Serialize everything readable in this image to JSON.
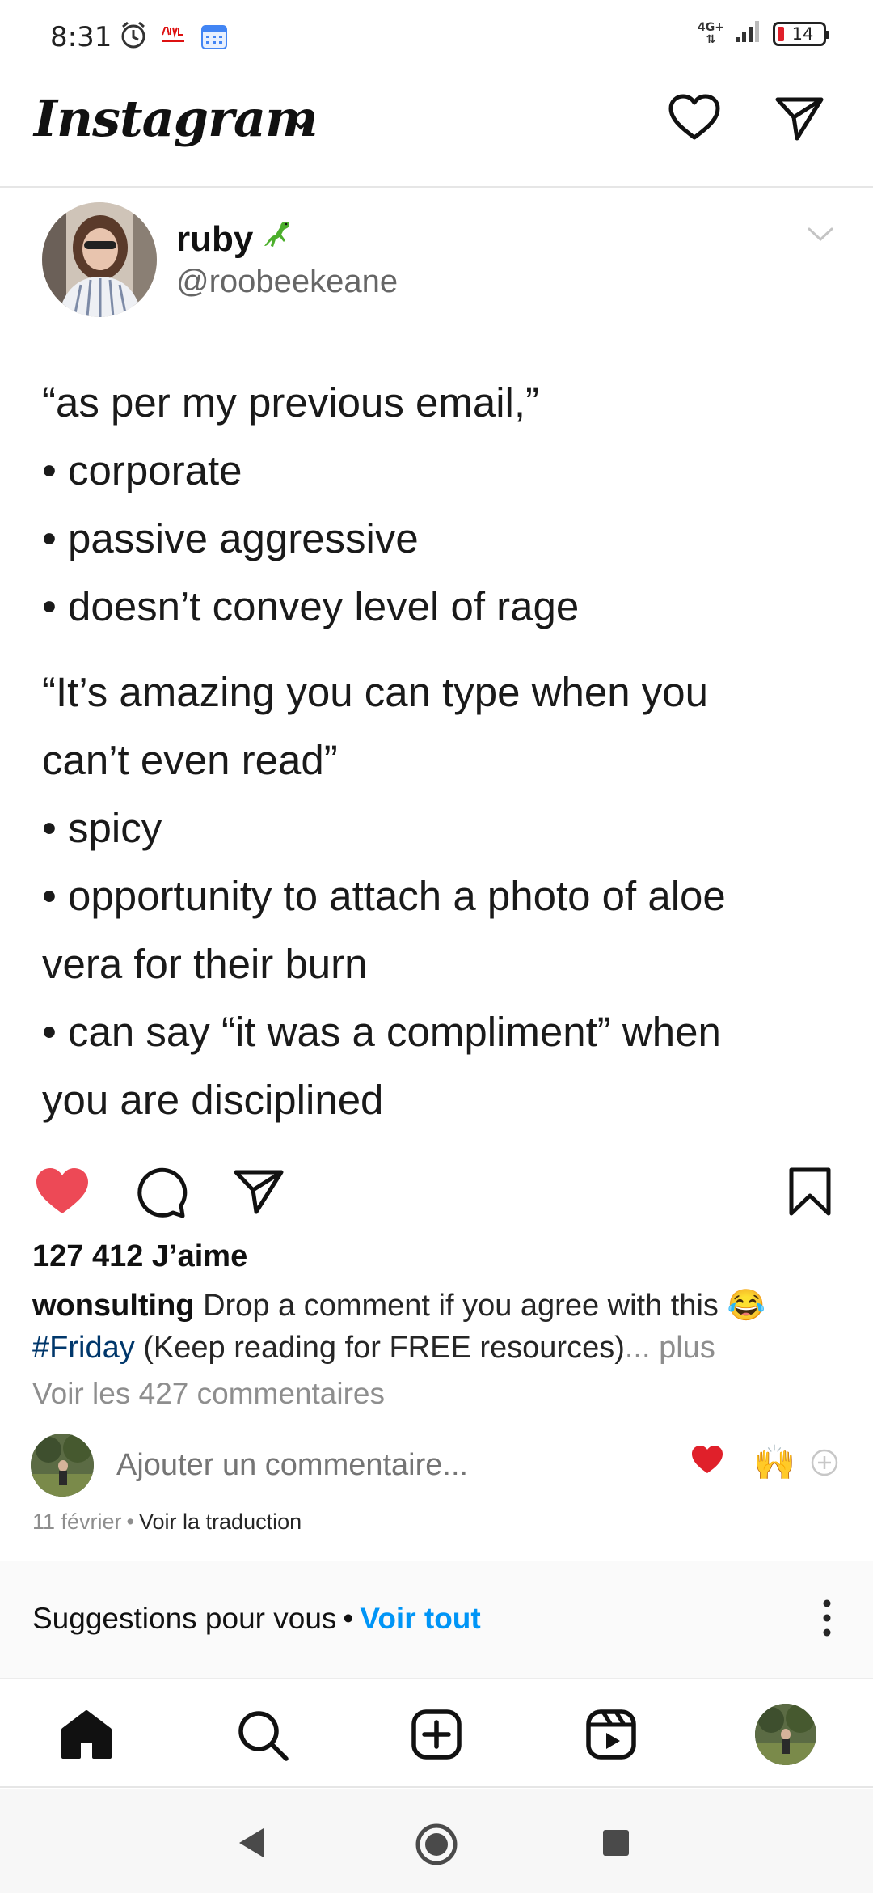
{
  "status_bar": {
    "time": "8:31",
    "network_type": "4G+",
    "battery_level": "14",
    "icons": [
      "alarm-icon",
      "news-app-icon",
      "calendar-icon",
      "signal-icon",
      "battery-icon"
    ]
  },
  "header": {
    "app_name": "Instagram",
    "icons": [
      "chevron-down-icon",
      "heart-icon",
      "direct-send-icon"
    ]
  },
  "post": {
    "author_name": "ruby",
    "author_handle": "@roobeekeane",
    "tweet_lines": [
      "“as per my previous email,”",
      "• corporate",
      "• passive aggressive",
      "• doesn’t convey level of rage",
      "“It’s amazing you can type when you",
      "can’t even read”",
      "• spicy",
      "• opportunity to attach a photo of aloe",
      "vera for their burn",
      "• can say “it was a compliment” when",
      "you are disciplined"
    ],
    "likes": "127 412 J’aime",
    "caption_user": "wonsulting",
    "caption_text": " Drop a comment if you agree with this 😂",
    "caption_tag": "#Friday",
    "caption_rest": " (Keep reading for FREE resources)",
    "caption_more": "... plus",
    "view_comments": "Voir les 427 commentaires",
    "comment_placeholder": "Ajouter un commentaire...",
    "quick_reaction_hands": "🙌",
    "date": "11 février",
    "date_sep": "•",
    "translate": "Voir la traduction"
  },
  "suggestions": {
    "title": "Suggestions pour vous",
    "sep": "•",
    "see_all": "Voir tout"
  },
  "colors": {
    "like_red": "#ed4956",
    "link_blue": "#0095f6",
    "hashtag_blue": "#00376b",
    "muted_gray": "#8e8e8e"
  }
}
